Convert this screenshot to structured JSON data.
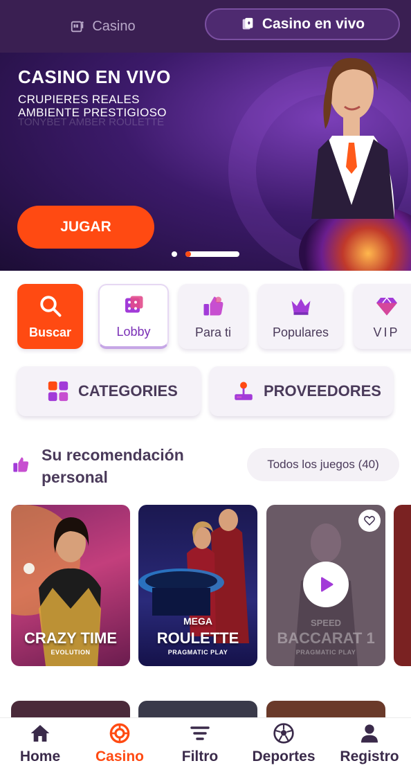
{
  "top_tabs": {
    "casino_label": "Casino",
    "live_label": "Casino en vivo"
  },
  "banner": {
    "title": "CASINO EN VIVO",
    "subtitle_line1": "CRUPIERES REALES",
    "subtitle_line2": "AMBIENTE PRESTIGIOSO",
    "ghost_text": "TONYBET AMBER ROULETTE",
    "cta_label": "JUGAR"
  },
  "categories": {
    "buscar": "Buscar",
    "lobby": "Lobby",
    "para_ti": "Para ti",
    "populares": "Populares",
    "vip": "VIP"
  },
  "buttons": {
    "categories": "CATEGORIES",
    "providers": "PROVEEDORES"
  },
  "recommendation": {
    "title": "Su recomendación personal",
    "all_games": "Todos los juegos (40)"
  },
  "games": [
    {
      "name": "CRAZY TIME",
      "provider": "EVOLUTION"
    },
    {
      "name_line1": "MEGA",
      "name_line2": "ROULETTE",
      "provider": "PRAGMATIC PLAY"
    },
    {
      "name_line1": "SPEED",
      "name_line2": "BACCARAT 1",
      "provider": "PRAGMATIC PLAY"
    }
  ],
  "bottom_nav": {
    "home": "Home",
    "casino": "Casino",
    "filtro": "Filtro",
    "deportes": "Deportes",
    "registro": "Registro"
  },
  "colors": {
    "accent": "#ff4a12",
    "header_bg": "#3a1f52",
    "brand_purple": "#7a2fb6"
  }
}
